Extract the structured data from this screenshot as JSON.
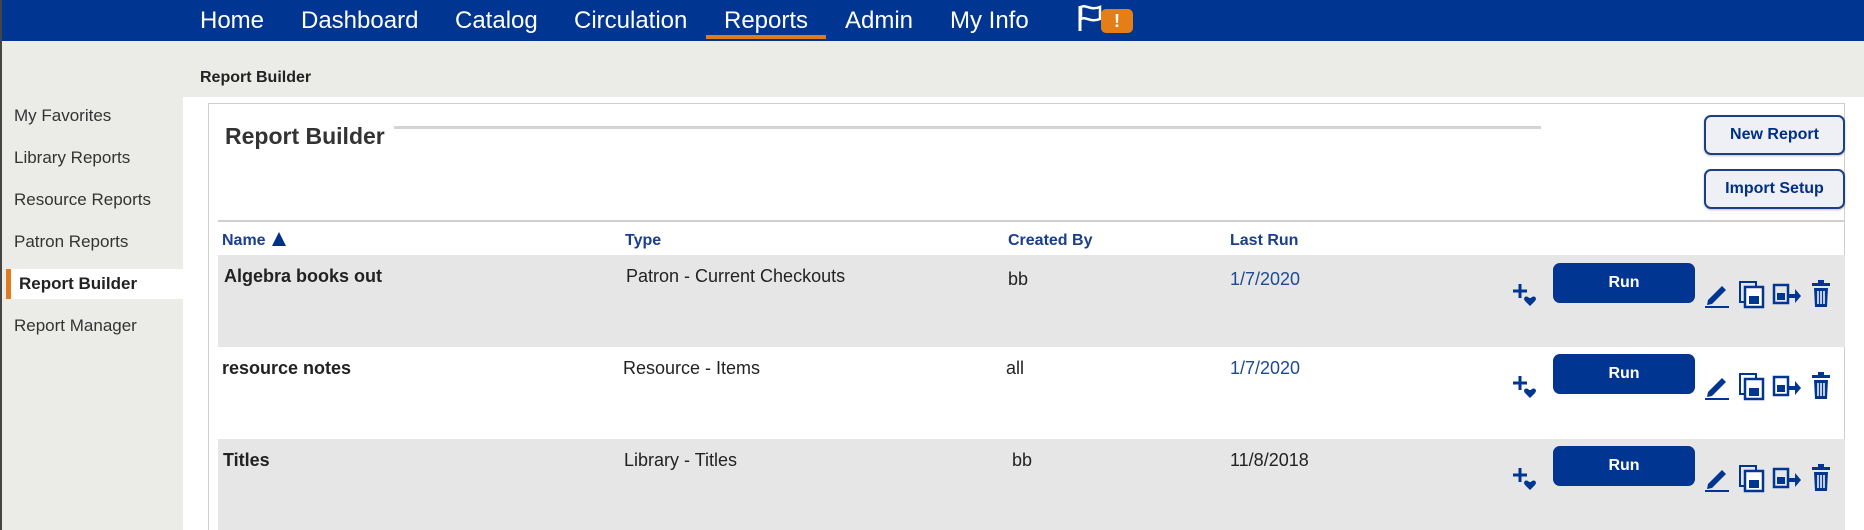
{
  "nav": {
    "tabs": [
      {
        "label": "Home"
      },
      {
        "label": "Dashboard"
      },
      {
        "label": "Catalog"
      },
      {
        "label": "Circulation"
      },
      {
        "label": "Reports",
        "active": true
      },
      {
        "label": "Admin"
      },
      {
        "label": "My Info"
      }
    ],
    "alert_badge": "!",
    "accent_color": "#e07a1f",
    "brand_color": "#003591"
  },
  "breadcrumb": "Report Builder",
  "sidebar": {
    "items": [
      {
        "label": "My Favorites"
      },
      {
        "label": "Library Reports"
      },
      {
        "label": "Resource Reports"
      },
      {
        "label": "Patron Reports"
      },
      {
        "label": "Report Builder",
        "active": true
      },
      {
        "label": "Report Manager"
      }
    ]
  },
  "main": {
    "title": "Report Builder",
    "new_report_label": "New Report",
    "import_setup_label": "Import Setup",
    "columns": {
      "name": "Name",
      "type": "Type",
      "created_by": "Created By",
      "last_run": "Last Run"
    },
    "sort": {
      "column": "name",
      "direction": "ascending",
      "icon": "sort-ascending-icon"
    },
    "run_label": "Run",
    "row_actions": [
      "add-favorite-icon",
      "edit-icon",
      "copy-icon",
      "export-icon",
      "delete-icon"
    ],
    "rows": [
      {
        "name": "Algebra books out",
        "type": "Patron - Current Checkouts",
        "created_by": "bb",
        "last_run": "1/7/2020"
      },
      {
        "name": "resource notes",
        "type": "Resource - Items",
        "created_by": "all",
        "last_run": "1/7/2020"
      },
      {
        "name": "Titles",
        "type": "Library - Titles",
        "created_by": "bb",
        "last_run": "11/8/2018"
      }
    ]
  }
}
